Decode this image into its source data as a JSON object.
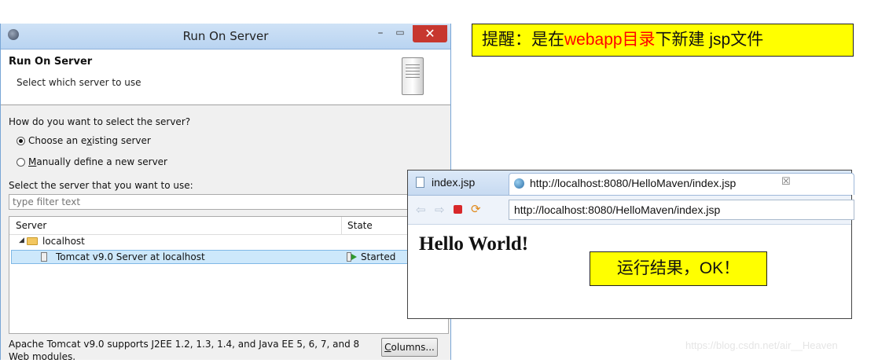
{
  "dialog": {
    "title": "Run On Server",
    "close_symbol": "✕",
    "minimize_symbol": "–",
    "maximize_symbol": "▭",
    "header_title": "Run On Server",
    "header_desc": "Select which server to use",
    "question": "How do you want to select the server?",
    "radio_existing_pre": "Choose an e",
    "radio_existing_u": "x",
    "radio_existing_post": "isting server",
    "radio_existing_selected": true,
    "radio_manual_u": "M",
    "radio_manual_post": "anually define a new server",
    "select_label": "Select the server that you want to use:",
    "filter_placeholder": "type filter text",
    "columns": {
      "server": "Server",
      "state": "State"
    },
    "tree": {
      "host_toggle": "◢",
      "host": "localhost",
      "server_name": "Tomcat v9.0 Server at localhost",
      "server_state": "Started"
    },
    "description": "Apache Tomcat v9.0 supports J2EE 1.2, 1.3, 1.4, and Java EE 5, 6, 7, and 8 Web modules.",
    "columns_button_u": "C",
    "columns_button_post": "olumns..."
  },
  "browser": {
    "tab1_label": "index.jsp",
    "tab2_label": "http://localhost:8080/HelloMaven/index.jsp",
    "tab2_close": "☒",
    "back_symbol": "⇦",
    "forward_symbol": "⇨",
    "refresh_symbol": "⟳",
    "url": "http://localhost:8080/HelloMaven/index.jsp",
    "page_heading": "Hello World!"
  },
  "annotations": {
    "note1_a": "提醒：是在",
    "note1_red": "webapp目录",
    "note1_b": "下新建 jsp文件",
    "note2": "运行结果，OK！"
  },
  "watermark": "https://blog.csdn.net/air__Heaven",
  "colors": {
    "note_bg": "#ffff00",
    "note_highlight": "#ff0000",
    "close_button": "#c7372f",
    "selection": "#cde8fb"
  }
}
